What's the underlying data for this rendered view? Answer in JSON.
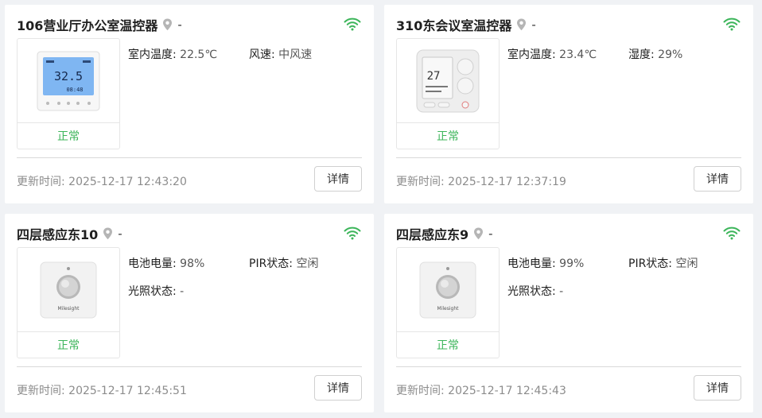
{
  "cards": [
    {
      "title": "106营业厅办公室温控器",
      "location": "-",
      "status": "正常",
      "props": [
        {
          "key": "室内温度:",
          "value": "22.5℃"
        },
        {
          "key": "风速:",
          "value": "中风速"
        }
      ],
      "updated_label": "更新时间:",
      "updated_time": "2025-12-17 12:43:20",
      "detail_label": "详情",
      "device_icon": "thermostat-lcd-icon"
    },
    {
      "title": "310东会议室温控器",
      "location": "-",
      "status": "正常",
      "props": [
        {
          "key": "室内温度:",
          "value": "23.4℃"
        },
        {
          "key": "湿度:",
          "value": "29%"
        }
      ],
      "updated_label": "更新时间:",
      "updated_time": "2025-12-17 12:37:19",
      "detail_label": "详情",
      "device_icon": "thermostat-panel-icon"
    },
    {
      "title": "四层感应东10",
      "location": "-",
      "status": "正常",
      "props": [
        {
          "key": "电池电量:",
          "value": "98%"
        },
        {
          "key": "PIR状态:",
          "value": "空闲"
        },
        {
          "key": "光照状态:",
          "value": "-"
        }
      ],
      "updated_label": "更新时间:",
      "updated_time": "2025-12-17 12:45:51",
      "detail_label": "详情",
      "device_icon": "pir-sensor-icon"
    },
    {
      "title": "四层感应东9",
      "location": "-",
      "status": "正常",
      "props": [
        {
          "key": "电池电量:",
          "value": "99%"
        },
        {
          "key": "PIR状态:",
          "value": "空闲"
        },
        {
          "key": "光照状态:",
          "value": "-"
        }
      ],
      "updated_label": "更新时间:",
      "updated_time": "2025-12-17 12:45:43",
      "detail_label": "详情",
      "device_icon": "pir-sensor-icon"
    }
  ],
  "device_image_text": {
    "lcd_temp": "32.5",
    "lcd_time": "08:48",
    "panel_temp": "27",
    "sensor_brand": "Milesight"
  },
  "colors": {
    "online": "#3cb55a",
    "status_ok": "#3cb55a",
    "lcd": "#7fb6f2"
  },
  "icons": {
    "location": "location-pin-icon",
    "signal": "wifi-signal-icon"
  }
}
